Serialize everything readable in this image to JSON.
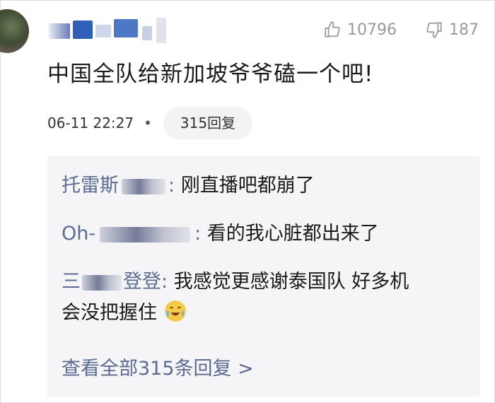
{
  "comment": {
    "likes": "10796",
    "dislikes": "187",
    "text": "中国全队给新加坡爷爷磕一个吧!",
    "timestamp": "06-11 22:27",
    "separator": "•",
    "reply_count_label": "315回复"
  },
  "replies": [
    {
      "name_prefix": "托雷斯",
      "name_suffix": ":",
      "text": "刚直播吧都崩了"
    },
    {
      "name_prefix": "Oh-",
      "name_suffix": ":",
      "text": "看的我心脏都出来了"
    },
    {
      "name_prefix": "三",
      "name_mid": "登登",
      "name_suffix": ":",
      "text": "我感觉更感谢泰国队 好多机",
      "text_line2": "会没把握住"
    }
  ],
  "view_all_label": "查看全部315条回复 >",
  "colors": {
    "link": "#5b6c92",
    "reply_bg": "#f5f5f7",
    "muted": "#999999"
  },
  "icons": [
    "thumbs-up-icon",
    "thumbs-down-icon",
    "crying-laugh-emoji-icon"
  ]
}
